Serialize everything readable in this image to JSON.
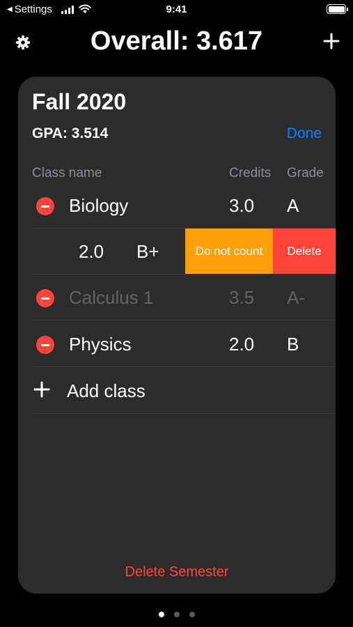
{
  "status_bar": {
    "back_label": "Settings",
    "time": "9:41"
  },
  "header": {
    "overall": "Overall: 3.617"
  },
  "semester": {
    "title": "Fall 2020",
    "gpa": "GPA: 3.514",
    "done_label": "Done",
    "columns": {
      "name": "Class name",
      "credits": "Credits",
      "grade": "Grade"
    },
    "classes": [
      {
        "name": "Biology",
        "credits": "3.0",
        "grade": "A"
      },
      {
        "name": "",
        "credits": "2.0",
        "grade": "B+"
      },
      {
        "name": "Calculus 1",
        "credits": "3.5",
        "grade": "A-"
      },
      {
        "name": "Physics",
        "credits": "2.0",
        "grade": "B"
      }
    ],
    "swipe_actions": {
      "do_not_count": "Do not count",
      "delete": "Delete"
    },
    "add_class_label": "Add class",
    "delete_semester_label": "Delete Semester"
  },
  "pager": {
    "pages": 3,
    "current": 1
  },
  "colors": {
    "accent": "#0a84ff",
    "destructive": "#ff453a",
    "warning": "#ff9f0a",
    "card": "#2c2c2e"
  }
}
